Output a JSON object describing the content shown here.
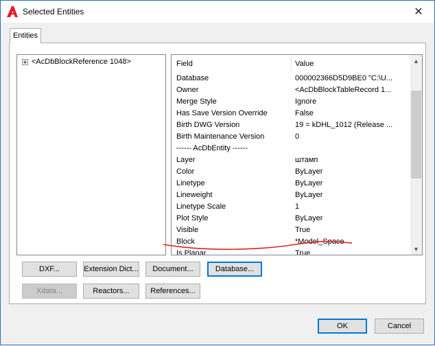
{
  "window": {
    "title": "Selected Entities",
    "close_glyph": "✕",
    "icon": "autocad-logo-icon",
    "brand_color": "#e51b24"
  },
  "tabs": [
    {
      "label": "Entities",
      "active": true
    }
  ],
  "tree": {
    "items": [
      {
        "label": "<AcDbBlockReference   1048>",
        "expanded": false
      }
    ]
  },
  "properties": {
    "columns": {
      "field": "Field",
      "value": "Value"
    },
    "rows": [
      {
        "field": "Database",
        "value": "000002366D5D9BE0  \"C:\\U..."
      },
      {
        "field": "Owner",
        "value": "<AcDbBlockTableRecord 1..."
      },
      {
        "field": "Merge Style",
        "value": "Ignore"
      },
      {
        "field": "Has Save Version Override",
        "value": "False"
      },
      {
        "field": "Birth DWG Version",
        "value": "19 = kDHL_1012  (Release ..."
      },
      {
        "field": "Birth Maintenance Version",
        "value": "0"
      },
      {
        "field": "------ AcDbEntity ------",
        "value": ""
      },
      {
        "field": "Layer",
        "value": "штамп"
      },
      {
        "field": "Color",
        "value": "ByLayer"
      },
      {
        "field": "Linetype",
        "value": "ByLayer"
      },
      {
        "field": "Lineweight",
        "value": "ByLayer"
      },
      {
        "field": "Linetype Scale",
        "value": "1"
      },
      {
        "field": "Plot Style",
        "value": "ByLayer"
      },
      {
        "field": "Visible",
        "value": "True"
      },
      {
        "field": "Block",
        "value": "*Model_Space"
      },
      {
        "field": "Is Planar",
        "value": "True"
      }
    ],
    "annotation_color": "#e0211d"
  },
  "buttons": {
    "dxf": "DXF...",
    "extension_dict": "Extension Dict...",
    "document": "Document...",
    "database": "Database...",
    "xdata": "Xdata...",
    "reactors": "Reactors...",
    "references": "References...",
    "ok": "OK",
    "cancel": "Cancel"
  },
  "colors": {
    "focus_accent": "#0078d7",
    "window_border": "#2b6fb3"
  }
}
